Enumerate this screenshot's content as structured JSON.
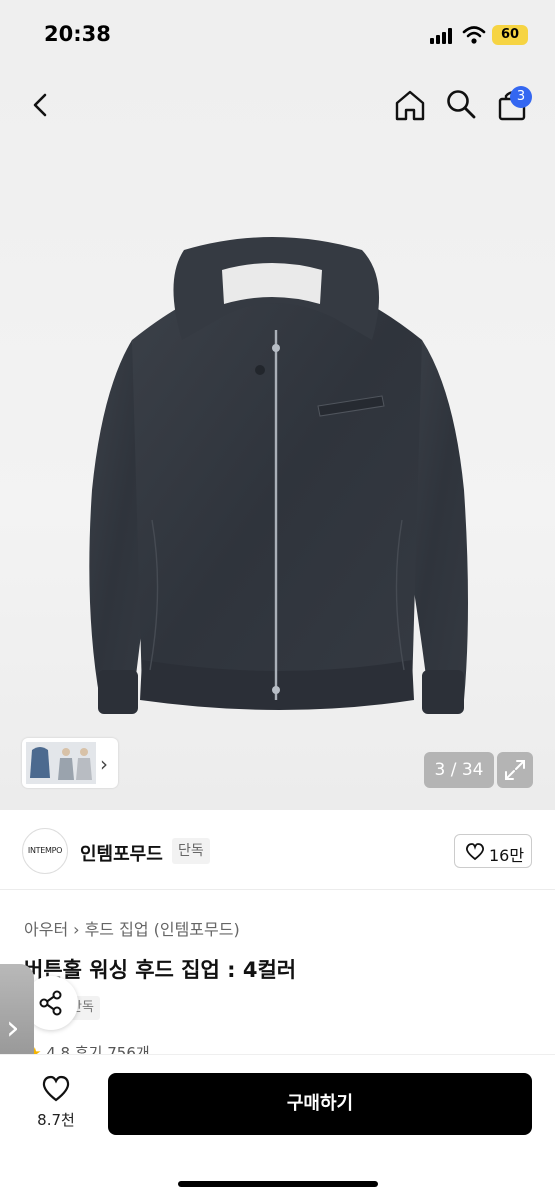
{
  "status_bar": {
    "time": "20:38",
    "battery": "60"
  },
  "header": {
    "icons": [
      "back-icon",
      "home-icon",
      "search-icon",
      "shopping-bag-icon"
    ],
    "cart_count": "3"
  },
  "gallery": {
    "counter": "3 / 34"
  },
  "brand": {
    "logo_text": "INTEMPO",
    "name": "인템포무드",
    "tag": "단독",
    "follow_count": "16만"
  },
  "product": {
    "breadcrumb": [
      "아우터",
      "후드 집업 (인템포무드)"
    ],
    "title": "버튼홀 워싱 후드 집업 : 4컬러",
    "exclusive_tag": "단독",
    "rating": "4.8",
    "review_text": "후기 756개"
  },
  "bottom_bar": {
    "like_count": "8.7천",
    "buy_label": "구매하기"
  },
  "colors": {
    "cart_badge": "#3467f1",
    "buy_button": "#000000",
    "star": "#f4b400"
  }
}
